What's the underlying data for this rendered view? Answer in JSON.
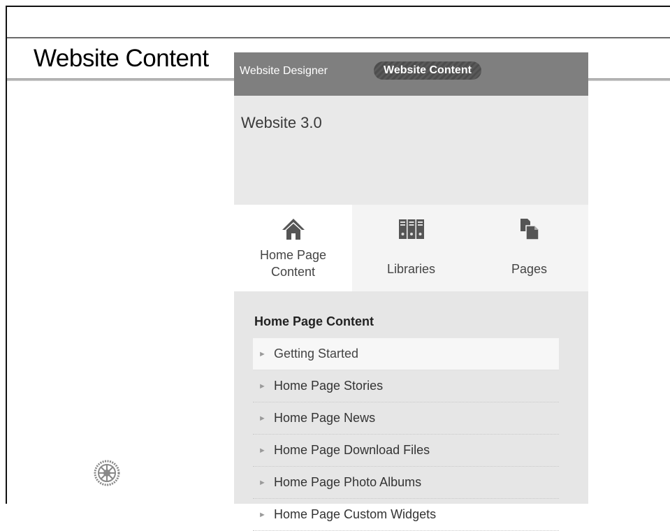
{
  "slide": {
    "title": "Website Content"
  },
  "panel": {
    "tabs": {
      "designer": "Website Designer",
      "content": "Website Content"
    },
    "header": "Website 3.0",
    "nav": [
      {
        "label_line1": "Home Page",
        "label_line2": "Content",
        "icon": "home-icon"
      },
      {
        "label_line1": "Libraries",
        "icon": "libraries-icon"
      },
      {
        "label_line1": "Pages",
        "icon": "pages-icon"
      }
    ],
    "section_title": "Home Page Content",
    "items": [
      {
        "label": "Getting Started"
      },
      {
        "label": "Home Page Stories"
      },
      {
        "label": "Home Page News"
      },
      {
        "label": "Home Page Download Files"
      },
      {
        "label": "Home Page Photo Albums"
      },
      {
        "label": "Home Page Custom Widgets"
      }
    ]
  },
  "logo": {
    "icon": "rotary-wheel-icon"
  }
}
